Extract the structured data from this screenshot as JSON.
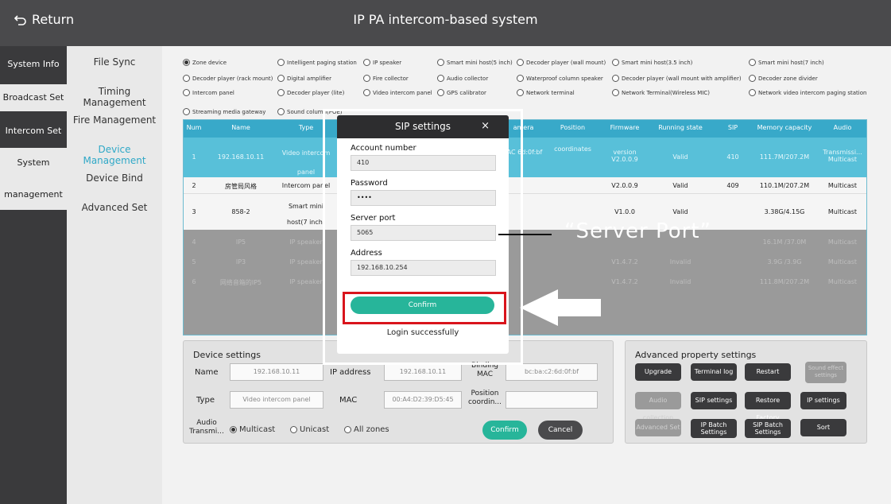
{
  "header": {
    "return_label": "Return",
    "title": "IP PA intercom-based system"
  },
  "leftnav": [
    {
      "label": "System Info"
    },
    {
      "label": "Broadcast Set"
    },
    {
      "label": "Intercom Set"
    },
    {
      "label": "System"
    },
    {
      "label": "management"
    }
  ],
  "subnav": [
    {
      "label": "File Sync"
    },
    {
      "label": "Timing Management"
    },
    {
      "label": "Fire Management"
    },
    {
      "label": "Device Management"
    },
    {
      "label": "Device Bind"
    },
    {
      "label": "Advanced Set"
    }
  ],
  "device_types": [
    {
      "label": "Zone device",
      "selected": true
    },
    {
      "label": "Intelligent paging station",
      "selected": false
    },
    {
      "label": "IP speaker",
      "selected": false
    },
    {
      "label": "Smart mini host(5 inch)",
      "selected": false
    },
    {
      "label": "Decoder player (wall mount)",
      "selected": false
    },
    {
      "label": "Smart mini host(3.5 inch)",
      "selected": false
    },
    {
      "label": "Smart mini host(7 inch)",
      "selected": false
    },
    {
      "label": "Decoder player (rack mount)",
      "selected": false
    },
    {
      "label": "Digital amplifier",
      "selected": false
    },
    {
      "label": "Fire collector",
      "selected": false
    },
    {
      "label": "Audio collector",
      "selected": false
    },
    {
      "label": "Waterproof column speaker",
      "selected": false
    },
    {
      "label": "Decoder player (wall mount with amplifier)",
      "selected": false
    },
    {
      "label": "Decoder zone divider",
      "selected": false
    },
    {
      "label": "Intercom panel",
      "selected": false
    },
    {
      "label": "Decoder player (lite)",
      "selected": false
    },
    {
      "label": "Video intercom panel",
      "selected": false
    },
    {
      "label": "GPS calibrator",
      "selected": false
    },
    {
      "label": "Network terminal",
      "selected": false
    },
    {
      "label": "Network Terminal(Wireless MIC)",
      "selected": false
    },
    {
      "label": "Network video intercom paging station",
      "selected": false
    },
    {
      "label": "Streaming media gateway",
      "selected": false
    },
    {
      "label": "Sound column(POE)",
      "selected": false
    }
  ],
  "table": {
    "headers": [
      "Num",
      "Name",
      "Type",
      "",
      "amera",
      "Position",
      "Firmware",
      "Running state",
      "SIP",
      "Memory capacity",
      "Audio"
    ],
    "rows": [
      {
        "num": "1",
        "name": "192.168.10.11",
        "type": "Video intercom panel",
        "camera": "AC 6d:0f:bf",
        "position": "coordinates",
        "firmware": "version V2.0.0.9",
        "state": "Valid",
        "sip": "410",
        "memory": "111.7M/207.2M",
        "audio": "Transmissi... Multicast"
      },
      {
        "num": "2",
        "name": "房管局风格",
        "type": "Intercom panel",
        "camera": "",
        "position": "",
        "firmware": "V2.0.0.9",
        "state": "Valid",
        "sip": "409",
        "memory": "110.1M/207.2M",
        "audio": "Multicast"
      },
      {
        "num": "3",
        "name": "858-2",
        "type": "Smart mini host(7 inch)",
        "camera": "",
        "position": "",
        "firmware": "V1.0.0",
        "state": "Valid",
        "sip": "",
        "memory": "3.38G/4.15G",
        "audio": "Multicast"
      },
      {
        "num": "4",
        "name": "IP5",
        "type": "IP speaker",
        "camera": "",
        "position": "",
        "firmware": "",
        "state": "",
        "sip": "",
        "memory": "16.1M /37.0M",
        "audio": "Multicast"
      },
      {
        "num": "5",
        "name": "IP3",
        "type": "IP speaker",
        "camera": "",
        "position": "",
        "firmware": "V1.4.7.2",
        "state": "Invalid",
        "sip": "",
        "memory": "3.9G /3.9G",
        "audio": "Multicast"
      },
      {
        "num": "6",
        "name": "网络音箱的IP5",
        "type": "IP speaker",
        "camera": "",
        "position": "",
        "firmware": "V1.4.7.2",
        "state": "Invalid",
        "sip": "",
        "memory": "111.8M/207.2M",
        "audio": "Multicast"
      }
    ]
  },
  "device_settings": {
    "title": "Device settings",
    "name_label": "Name",
    "name_value": "192.168.10.11",
    "ip_label": "IP address",
    "ip_value": "192.168.10.11",
    "binding_label": "Binding MAC",
    "binding_value": "bc:ba:c2:6d:0f:bf",
    "type_label": "Type",
    "type_value": "Video intercom panel",
    "mac_label": "MAC",
    "mac_value": "00:A4:D2:39:D5:45",
    "position_label": "Position coordin...",
    "position_value": "",
    "audio_label": "Audio Transmi...",
    "audio_options": [
      {
        "label": "Multicast",
        "selected": true
      },
      {
        "label": "Unicast",
        "selected": false
      },
      {
        "label": "All zones",
        "selected": false
      }
    ],
    "confirm_label": "Confirm",
    "cancel_label": "Cancel"
  },
  "advanced_settings": {
    "title": "Advanced property settings",
    "buttons": [
      {
        "label": "Upgrade",
        "enabled": true
      },
      {
        "label": "Terminal log",
        "enabled": true
      },
      {
        "label": "Restart",
        "enabled": true
      },
      {
        "label": "Sound effect settings",
        "enabled": false
      },
      {
        "label": "Audio collection",
        "enabled": false
      },
      {
        "label": "SIP settings",
        "enabled": true
      },
      {
        "label": "Restore Factory",
        "enabled": true
      },
      {
        "label": "IP settings",
        "enabled": true
      },
      {
        "label": "Advanced Set",
        "enabled": false
      },
      {
        "label": "IP Batch Settings",
        "enabled": true
      },
      {
        "label": "SIP Batch Settings",
        "enabled": true
      },
      {
        "label": "Sort",
        "enabled": true
      }
    ]
  },
  "sip_dialog": {
    "title": "SIP settings",
    "close": "×",
    "account_label": "Account number",
    "account_value": "410",
    "password_label": "Password",
    "password_value": "••••",
    "port_label": "Server port",
    "port_value": "5065",
    "address_label": "Address",
    "address_value": "192.168.10.254",
    "confirm_label": "Confirm",
    "status": "Login successfully"
  },
  "annotation": {
    "callout": "“Server Port”"
  },
  "colors": {
    "accent": "#38a9c9",
    "selected_row": "#58c0d9",
    "confirm_green": "#27b59a",
    "highlight_red": "#d9141c"
  }
}
